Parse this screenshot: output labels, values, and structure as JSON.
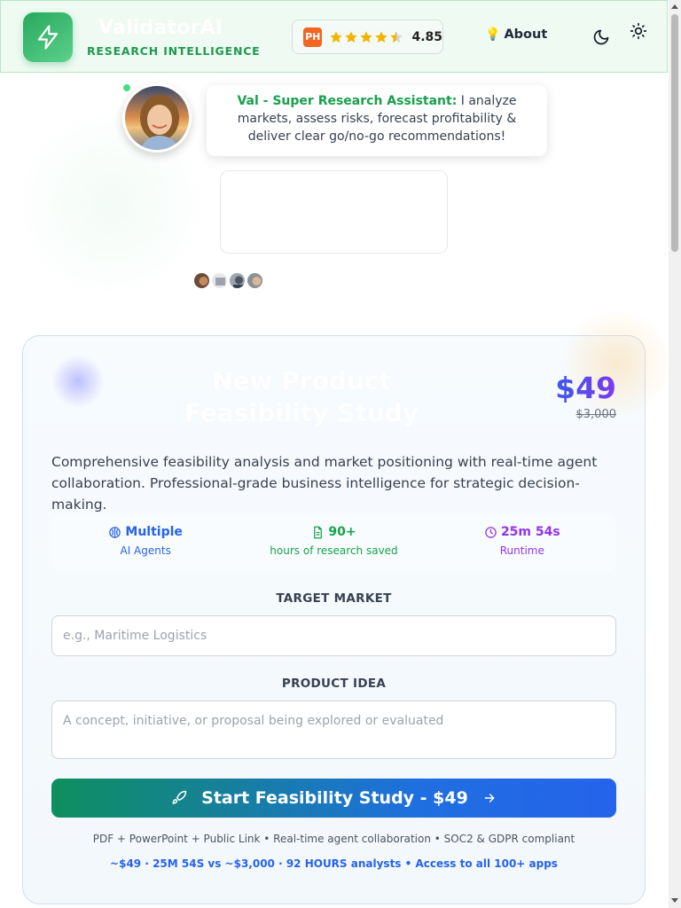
{
  "header": {
    "brand_name": "ValidatorAI",
    "brand_tagline": "RESEARCH INTELLIGENCE",
    "ph_badge_label": "PH",
    "ph_rating": "4.85",
    "ph_stars": 4.5,
    "about_label": "About",
    "about_icon": "lightbulb-icon",
    "theme_icons": [
      "moon-icon",
      "sun-icon"
    ]
  },
  "hero": {
    "assistant_name": "Val - Super Research Assistant:",
    "assistant_message": "I analyze markets, assess risks, forecast profitability & deliver clear go/no-go recommendations!",
    "status": "online"
  },
  "card": {
    "title": "New Product Feasibility Study",
    "price": "$49",
    "price_original": "$3,000",
    "description": "Comprehensive feasibility analysis and market positioning with real-time agent collaboration. Professional-grade business intelligence for strategic decision-making.",
    "stats": [
      {
        "value": "Multiple",
        "label": "AI Agents",
        "icon": "brain-icon"
      },
      {
        "value": "90+",
        "label": "hours of research saved",
        "icon": "document-icon"
      },
      {
        "value": "25m 54s",
        "label": "Runtime",
        "icon": "clock-icon"
      }
    ],
    "target_market": {
      "label": "TARGET MARKET",
      "placeholder": "e.g., Maritime Logistics",
      "value": ""
    },
    "product_idea": {
      "label": "PRODUCT IDEA",
      "placeholder": "A concept, initiative, or proposal being explored or evaluated",
      "value": ""
    },
    "cta_label": "Start Feasibility Study - $49",
    "footnote": "PDF + PowerPoint + Public Link • Real-time agent collaboration • SOC2 & GDPR compliant",
    "footnote_highlight": "~$49 · 25M 54S vs ~$3,000 · 92 HOURS analysts • Access to all 100+ apps"
  },
  "colors": {
    "brand_green": "#1f9a4f",
    "accent_blue": "#2563eb",
    "accent_purple": "#9333ea",
    "ph_orange": "#f26522"
  }
}
